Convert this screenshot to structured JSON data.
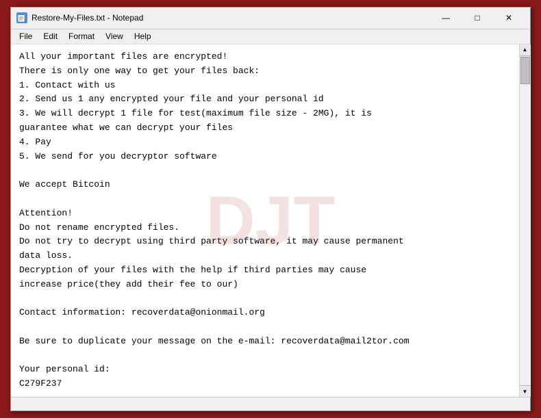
{
  "window": {
    "title": "Restore-My-Files.txt - Notepad",
    "icon_label": "notepad-icon"
  },
  "title_bar_controls": {
    "minimize": "—",
    "maximize": "□",
    "close": "✕"
  },
  "menu": {
    "items": [
      "File",
      "Edit",
      "Format",
      "View",
      "Help"
    ]
  },
  "content": {
    "text": "All your important files are encrypted!\nThere is only one way to get your files back:\n1. Contact with us\n2. Send us 1 any encrypted your file and your personal id\n3. We will decrypt 1 file for test(maximum file size - 2MG), it is\nguarantee what we can decrypt your files\n4. Pay\n5. We send for you decryptor software\n\nWe accept Bitcoin\n\nAttention!\nDo not rename encrypted files.\nDo not try to decrypt using third party software, it may cause permanent\ndata loss.\nDecryption of your files with the help if third parties may cause\nincrease price(they add their fee to our)\n\nContact information: recoverdata@onionmail.org\n\nBe sure to duplicate your message on the e-mail: recoverdata@mail2tor.com\n\nYour personal id:\nC279F237"
  },
  "watermark": {
    "text": "DJT"
  },
  "status_bar": {
    "text": ""
  }
}
